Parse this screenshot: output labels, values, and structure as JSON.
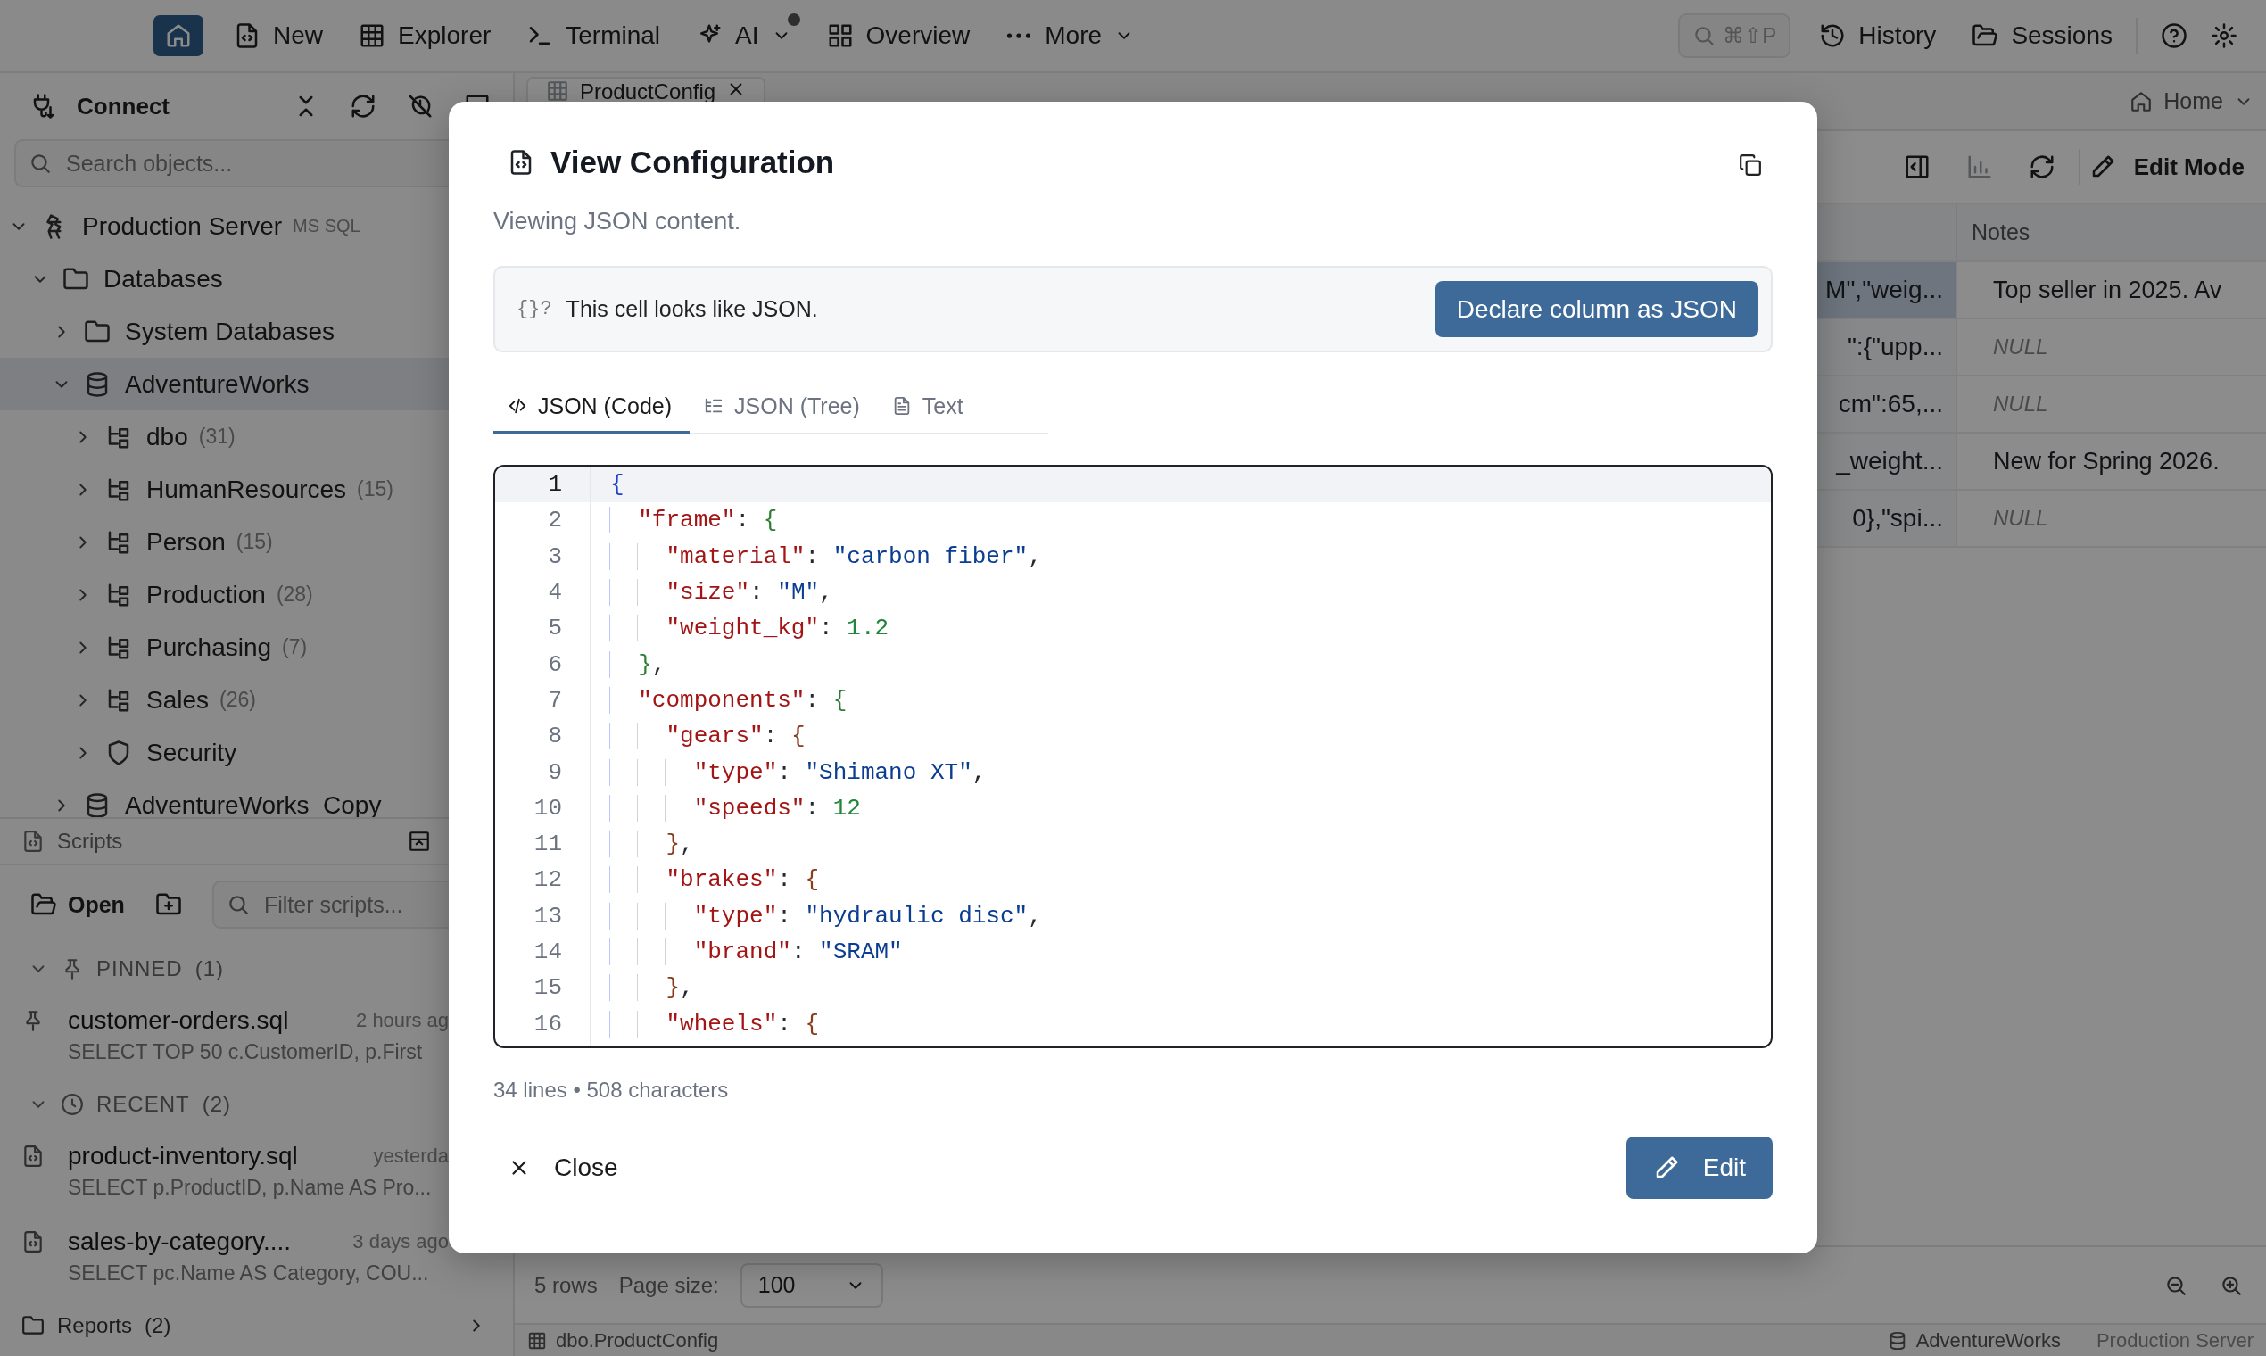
{
  "topbar": {
    "home": {
      "selected": true
    },
    "items": [
      {
        "label": "New",
        "menu": false,
        "notification": false
      },
      {
        "label": "Explorer",
        "menu": false,
        "notification": false
      },
      {
        "label": "Terminal",
        "menu": false,
        "notification": false
      },
      {
        "label": "AI",
        "menu": true,
        "notification": true
      },
      {
        "label": "Overview",
        "menu": false,
        "notification": false
      },
      {
        "label": "More",
        "menu": true,
        "notification": false
      }
    ],
    "search": {
      "shortcut": "⌘⇧P"
    },
    "links": [
      {
        "label": "History"
      },
      {
        "label": "Sessions"
      }
    ]
  },
  "explorer": {
    "title": "Connect",
    "search": {
      "placeholder": "Search objects..."
    },
    "tree": [
      {
        "label": "Production Server",
        "tag": "MS SQL",
        "kind": "server",
        "expanded": true,
        "selected": false,
        "children": [
          {
            "label": "Databases",
            "kind": "folder",
            "expanded": true,
            "selected": false,
            "children": [
              {
                "label": "System Databases",
                "kind": "folder",
                "expanded": false,
                "selected": false
              },
              {
                "label": "AdventureWorks",
                "kind": "database",
                "expanded": true,
                "selected": true,
                "children": [
                  {
                    "label": "dbo",
                    "count": "(31)",
                    "kind": "schema",
                    "expanded": false,
                    "selected": false
                  },
                  {
                    "label": "HumanResources",
                    "count": "(15)",
                    "kind": "schema",
                    "expanded": false,
                    "selected": false
                  },
                  {
                    "label": "Person",
                    "count": "(15)",
                    "kind": "schema",
                    "expanded": false,
                    "selected": false
                  },
                  {
                    "label": "Production",
                    "count": "(28)",
                    "kind": "schema",
                    "expanded": false,
                    "selected": false
                  },
                  {
                    "label": "Purchasing",
                    "count": "(7)",
                    "kind": "schema",
                    "expanded": false,
                    "selected": false
                  },
                  {
                    "label": "Sales",
                    "count": "(26)",
                    "kind": "schema",
                    "expanded": false,
                    "selected": false
                  },
                  {
                    "label": "Security",
                    "kind": "security",
                    "expanded": false,
                    "selected": false
                  }
                ]
              },
              {
                "label": "AdventureWorks_Copy",
                "kind": "database",
                "expanded": false,
                "selected": false
              }
            ]
          }
        ]
      }
    ]
  },
  "scripts": {
    "title": "Scripts",
    "open_label": "Open",
    "filter": {
      "placeholder": "Filter scripts..."
    },
    "groups": [
      {
        "label": "PINNED",
        "count": "(1)",
        "kind": "pinned",
        "expanded": true,
        "items": [
          {
            "name": "customer-orders.sql",
            "time": "2 hours ag",
            "preview": "SELECT TOP 50 c.CustomerID, p.First",
            "pinned": true
          }
        ]
      },
      {
        "label": "RECENT",
        "count": "(2)",
        "kind": "recent",
        "expanded": true,
        "items": [
          {
            "name": "product-inventory.sql",
            "time": "yesterda",
            "preview": "SELECT p.ProductID, p.Name AS Pro...",
            "pinned": false
          },
          {
            "name": "sales-by-category....",
            "time": "3 days ago",
            "preview": "SELECT pc.Name AS Category, COU...",
            "pinned": false
          }
        ]
      },
      {
        "label": "Reports",
        "count": "(2)",
        "kind": "folder",
        "expanded": false
      }
    ]
  },
  "main": {
    "tabs": [
      {
        "label": "ProductConfig",
        "selected": true
      }
    ],
    "breadcrumb": "Home",
    "edit_mode_label": "Edit Mode",
    "table": {
      "columns": [
        {
          "label": "Notes"
        }
      ],
      "rows": [
        {
          "column_1": "M\",\"weig...",
          "notes": "Top seller in 2025. Av",
          "notes_null": false,
          "selected": true
        },
        {
          "column_1": "\":{\"upp...",
          "notes": "NULL",
          "notes_null": true,
          "selected": false
        },
        {
          "column_1": "cm\":65,...",
          "notes": "NULL",
          "notes_null": true,
          "selected": false
        },
        {
          "column_1": "_weight...",
          "notes": "New for Spring 2026.",
          "notes_null": false,
          "selected": false
        },
        {
          "column_1": "0},\"spi...",
          "notes": "NULL",
          "notes_null": true,
          "selected": false
        }
      ]
    },
    "pager": {
      "rows": "5 rows",
      "page_size_label": "Page size:",
      "page_size": "100"
    },
    "status": {
      "table": "dbo.ProductConfig",
      "database": "AdventureWorks",
      "server": "Production Server"
    }
  },
  "dialog": {
    "title": "View Configuration",
    "subtitle": "Viewing JSON content.",
    "hint": {
      "glyph": "{}?",
      "text": "This cell looks like JSON.",
      "action": "Declare column as JSON"
    },
    "tabs": [
      {
        "label": "JSON (Code)",
        "selected": true
      },
      {
        "label": "JSON (Tree)",
        "selected": false
      },
      {
        "label": "Text",
        "selected": false
      }
    ],
    "lines": [
      {
        "number": "1",
        "text": "{",
        "active": true
      },
      {
        "number": "2",
        "text": "  \"frame\": {",
        "active": false
      },
      {
        "number": "3",
        "text": "    \"material\": \"carbon fiber\",",
        "active": false
      },
      {
        "number": "4",
        "text": "    \"size\": \"M\",",
        "active": false
      },
      {
        "number": "5",
        "text": "    \"weight_kg\": 1.2",
        "active": false
      },
      {
        "number": "6",
        "text": "  },",
        "active": false
      },
      {
        "number": "7",
        "text": "  \"components\": {",
        "active": false
      },
      {
        "number": "8",
        "text": "    \"gears\": {",
        "active": false
      },
      {
        "number": "9",
        "text": "      \"type\": \"Shimano XT\",",
        "active": false
      },
      {
        "number": "10",
        "text": "      \"speeds\": 12",
        "active": false
      },
      {
        "number": "11",
        "text": "    },",
        "active": false
      },
      {
        "number": "12",
        "text": "    \"brakes\": {",
        "active": false
      },
      {
        "number": "13",
        "text": "      \"type\": \"hydraulic disc\",",
        "active": false
      },
      {
        "number": "14",
        "text": "      \"brand\": \"SRAM\"",
        "active": false
      },
      {
        "number": "15",
        "text": "    },",
        "active": false
      },
      {
        "number": "16",
        "text": "    \"wheels\": {",
        "active": false
      }
    ],
    "footer": "34 lines • 508 characters",
    "close_label": "Close",
    "edit_label": "Edit"
  }
}
